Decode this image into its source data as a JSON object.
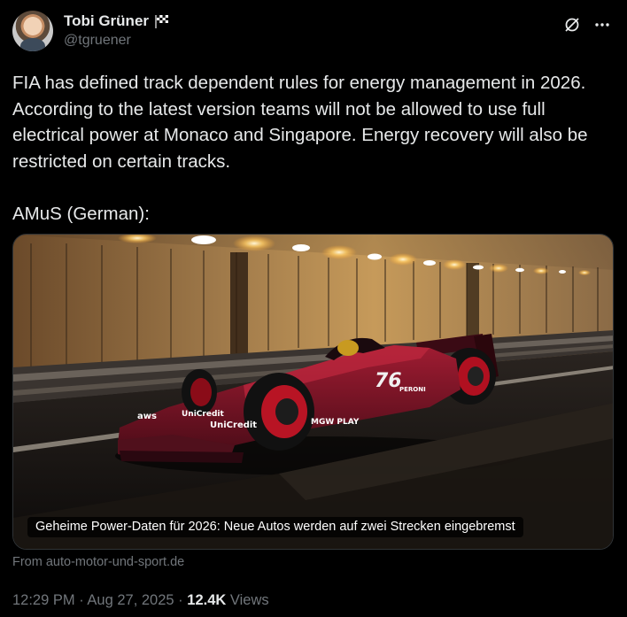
{
  "author": {
    "display_name": "Tobi Grüner",
    "handle": "@tgruener",
    "badge_icon": "checkered-flag-icon"
  },
  "actions": {
    "grok_icon": "grok-icon",
    "more_icon": "more-icon"
  },
  "post": {
    "text": "FIA has defined track dependent rules for energy management in 2026. According to the latest version teams will not be allowed to use full electrical power at Monaco and Singapore. Energy recovery will also be restricted on certain tracks.\n\nAMuS (German):",
    "media": {
      "caption": "Geheime Power-Daten für 2026: Neue Autos werden auf zwei Strecken eingebremst",
      "car_number": "76",
      "sponsor_labels": [
        "aws",
        "UniCredit",
        "UniCredit",
        "MGW PLAY",
        "PERONI"
      ]
    },
    "source": "From auto-motor-und-sport.de"
  },
  "meta": {
    "time": "12:29 PM",
    "separator": "·",
    "date": "Aug 27, 2025",
    "views_count": "12.4K",
    "views_label": "Views"
  },
  "colors": {
    "background": "#000000",
    "text": "#e7e9ea",
    "secondary": "#71767b",
    "car_body": "#7a1426"
  }
}
